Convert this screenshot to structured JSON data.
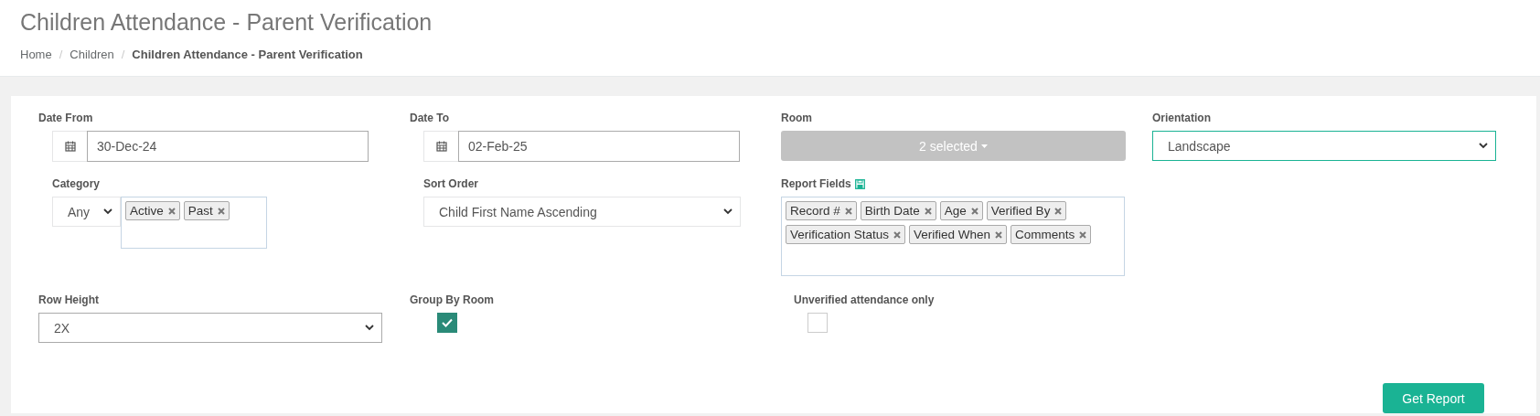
{
  "page_title": "Children Attendance - Parent Verification",
  "breadcrumb": [
    {
      "label": "Home",
      "current": false
    },
    {
      "label": "Children",
      "current": false
    },
    {
      "label": "Children Attendance - Parent Verification",
      "current": true
    }
  ],
  "separator": "/",
  "date_from": {
    "label": "Date From",
    "value": "30-Dec-24"
  },
  "date_to": {
    "label": "Date To",
    "value": "02-Feb-25"
  },
  "room": {
    "label": "Room",
    "value": "2 selected"
  },
  "orientation": {
    "label": "Orientation",
    "value": "Landscape"
  },
  "category": {
    "label": "Category",
    "value": "Any",
    "tags": [
      "Active",
      "Past"
    ]
  },
  "sort_order": {
    "label": "Sort Order",
    "value": "Child First Name Ascending"
  },
  "report_fields": {
    "label": "Report Fields",
    "tags": [
      "Record #",
      "Birth Date",
      "Age",
      "Verified By",
      "Verification Status",
      "Verified When",
      "Comments"
    ]
  },
  "row_height": {
    "label": "Row Height",
    "value": "2X"
  },
  "group_by_room": {
    "label": "Group By Room",
    "checked": true
  },
  "unverified_only": {
    "label": "Unverified attendance only",
    "checked": false
  },
  "button": "Get Report"
}
